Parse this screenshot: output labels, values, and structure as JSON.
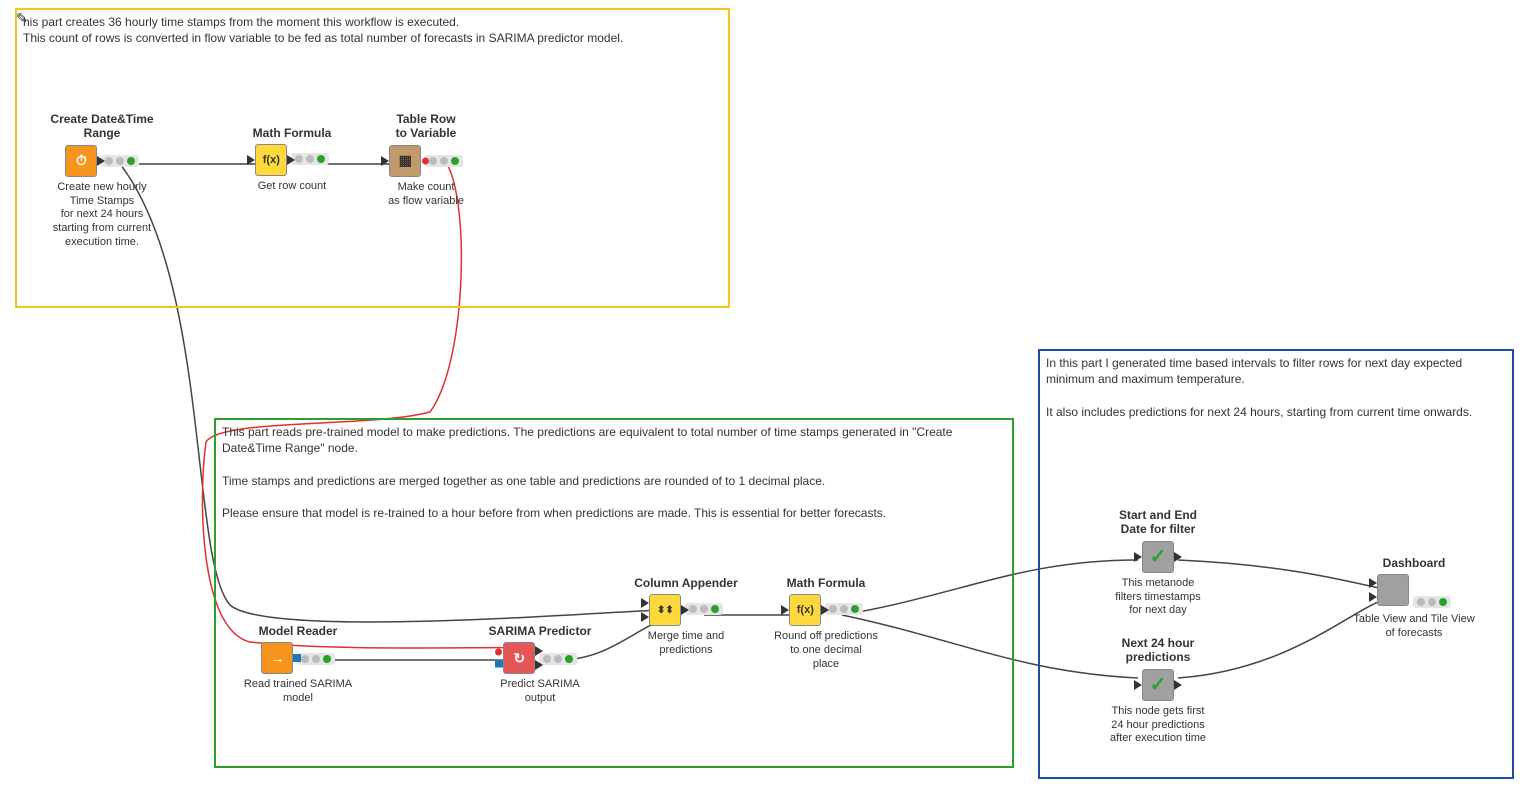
{
  "annotations": {
    "yellow": "his part creates 36 hourly time stamps from the moment this workflow is executed.\nThis count of rows is converted in flow variable to be fed as total number of forecasts in SARIMA predictor model.",
    "green": "This part reads pre-trained model to make predictions. The predictions are equivalent to total number of time stamps generated in \"Create Date&Time Range\" node.\n\nTime stamps and predictions are merged together as one table and predictions are rounded of to 1 decimal place.\n\nPlease ensure that model is re-trained to a hour before from when predictions are made. This is essential for better forecasts.",
    "blue": "In this part I generated time based intervals to filter rows for next day expected minimum and maximum temperature.\n\nIt also includes predictions for next 24 hours, starting from current time onwards."
  },
  "nodes": {
    "createDateTime": {
      "title": "Create Date&Time\nRange",
      "desc": "Create new hourly\nTime Stamps\nfor next 24 hours\nstarting from current\nexecution time.",
      "glyph": "⏱"
    },
    "mathFormula1": {
      "title": "Math Formula",
      "desc": "Get row count",
      "glyph": "f(x)"
    },
    "tableRowVar": {
      "title": "Table Row\nto Variable",
      "desc": "Make count\nas flow variable",
      "glyph": "▦"
    },
    "modelReader": {
      "title": "Model Reader",
      "desc": "Read trained SARIMA\nmodel",
      "glyph": "→"
    },
    "sarima": {
      "title": "SARIMA Predictor",
      "desc": "Predict SARIMA\noutput",
      "glyph": "↻"
    },
    "colAppender": {
      "title": "Column Appender",
      "desc": "Merge time and\npredictions",
      "glyph": "⬍⬍"
    },
    "mathFormula2": {
      "title": "Math Formula",
      "desc": "Round off predictions\nto one decimal\nplace",
      "glyph": "f(x)"
    },
    "startEnd": {
      "title": "Start and End\nDate for filter",
      "desc": "This metanode\nfilters timestamps\nfor next day",
      "glyph": "✓"
    },
    "next24": {
      "title": "Next 24 hour\npredictions",
      "desc": "This node gets first\n24 hour predictions\nafter execution time",
      "glyph": "✓"
    },
    "dashboard": {
      "title": "Dashboard",
      "desc": "Table View and Tile View\nof forecasts",
      "glyph": ""
    }
  },
  "icons": {
    "pencil": "✎"
  }
}
